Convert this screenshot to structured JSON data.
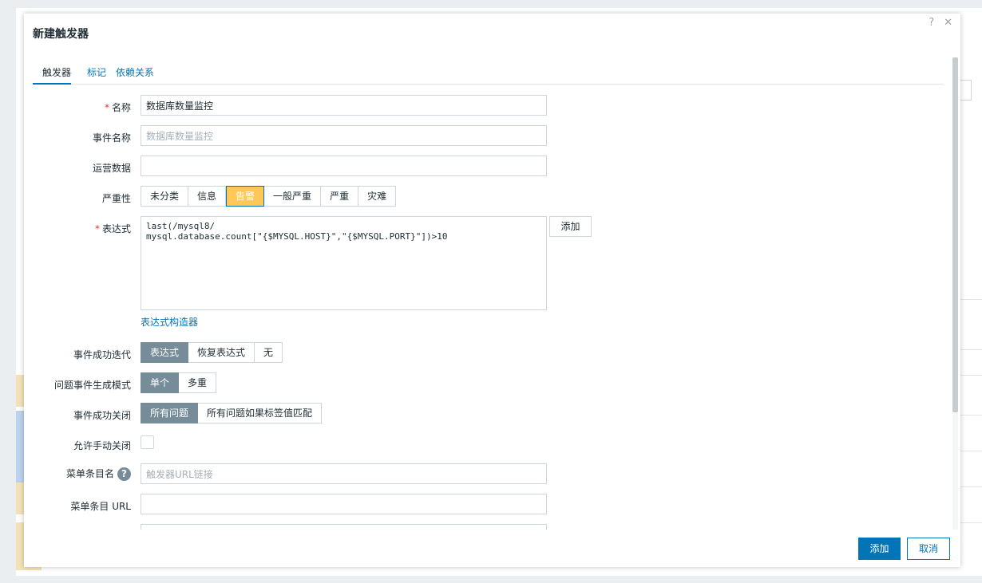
{
  "modal": {
    "title": "新建触发器",
    "help_glyph": "?",
    "close_glyph": "✕"
  },
  "tabs": [
    {
      "label": "触发器",
      "active": true
    },
    {
      "label": "标记",
      "active": false
    },
    {
      "label": "依赖关系",
      "active": false
    }
  ],
  "form": {
    "name": {
      "label": "名称",
      "required_mark": "*",
      "value": "数据库数量监控"
    },
    "event_name": {
      "label": "事件名称",
      "placeholder": "数据库数量监控"
    },
    "opdata": {
      "label": "运营数据",
      "value": ""
    },
    "severity": {
      "label": "严重性",
      "options": [
        "未分类",
        "信息",
        "告警",
        "一般严重",
        "严重",
        "灾难"
      ],
      "selected": "告警"
    },
    "expression": {
      "label": "表达式",
      "required_mark": "*",
      "value": "last(/mysql8/\nmysql.database.count[\"{$MYSQL.HOST}\",\"{$MYSQL.PORT}\"])>10",
      "add_label": "添加",
      "builder_link": "表达式构造器"
    },
    "ok_event_generation": {
      "label": "事件成功迭代",
      "options": [
        "表达式",
        "恢复表达式",
        "无"
      ],
      "selected": "表达式"
    },
    "problem_mode": {
      "label": "问题事件生成模式",
      "options": [
        "单个",
        "多重"
      ],
      "selected": "单个"
    },
    "ok_closes": {
      "label": "事件成功关闭",
      "options": [
        "所有问题",
        "所有问题如果标签值匹配"
      ],
      "selected": "所有问题"
    },
    "manual_close": {
      "label": "允许手动关闭",
      "checked": false
    },
    "menu_name": {
      "label": "菜单条目名",
      "help_glyph": "?",
      "placeholder": "触发器URL链接"
    },
    "menu_url": {
      "label": "菜单条目 URL",
      "value": ""
    }
  },
  "footer": {
    "add_label": "添加",
    "cancel_label": "取消"
  },
  "colors": {
    "accent": "#0275b8",
    "warning": "#ffc859",
    "segment_selected": "#768d99",
    "required": "#e33734"
  }
}
